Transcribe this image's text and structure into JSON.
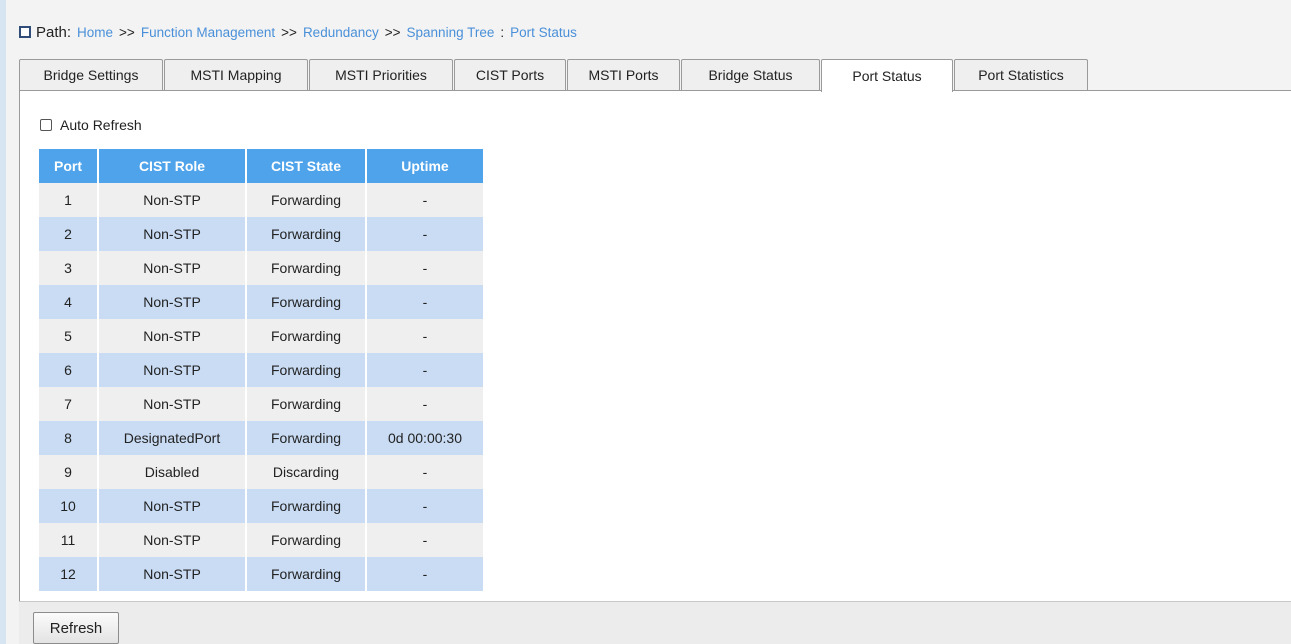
{
  "breadcrumb": {
    "prefix": "Path:",
    "items": [
      "Home",
      "Function Management",
      "Redundancy",
      "Spanning Tree",
      "Port Status"
    ],
    "separators": [
      ">>",
      ">>",
      ">>",
      ":"
    ]
  },
  "tabs": [
    {
      "label": "Bridge Settings",
      "active": false
    },
    {
      "label": "MSTI Mapping",
      "active": false
    },
    {
      "label": "MSTI Priorities",
      "active": false
    },
    {
      "label": "CIST Ports",
      "active": false
    },
    {
      "label": "MSTI Ports",
      "active": false
    },
    {
      "label": "Bridge Status",
      "active": false
    },
    {
      "label": "Port Status",
      "active": true
    },
    {
      "label": "Port Statistics",
      "active": false
    }
  ],
  "auto_refresh": {
    "label": "Auto Refresh",
    "checked": false
  },
  "table": {
    "headers": [
      "Port",
      "CIST Role",
      "CIST State",
      "Uptime"
    ],
    "rows": [
      [
        "1",
        "Non-STP",
        "Forwarding",
        "-"
      ],
      [
        "2",
        "Non-STP",
        "Forwarding",
        "-"
      ],
      [
        "3",
        "Non-STP",
        "Forwarding",
        "-"
      ],
      [
        "4",
        "Non-STP",
        "Forwarding",
        "-"
      ],
      [
        "5",
        "Non-STP",
        "Forwarding",
        "-"
      ],
      [
        "6",
        "Non-STP",
        "Forwarding",
        "-"
      ],
      [
        "7",
        "Non-STP",
        "Forwarding",
        "-"
      ],
      [
        "8",
        "DesignatedPort",
        "Forwarding",
        "0d 00:00:30"
      ],
      [
        "9",
        "Disabled",
        "Discarding",
        "-"
      ],
      [
        "10",
        "Non-STP",
        "Forwarding",
        "-"
      ],
      [
        "11",
        "Non-STP",
        "Forwarding",
        "-"
      ],
      [
        "12",
        "Non-STP",
        "Forwarding",
        "-"
      ]
    ]
  },
  "refresh_button": {
    "label": "Refresh"
  },
  "colors": {
    "header_bg": "#4ea3ea",
    "row_even": "#c9dcf4",
    "row_odd": "#efefef",
    "link": "#4a90d9"
  }
}
